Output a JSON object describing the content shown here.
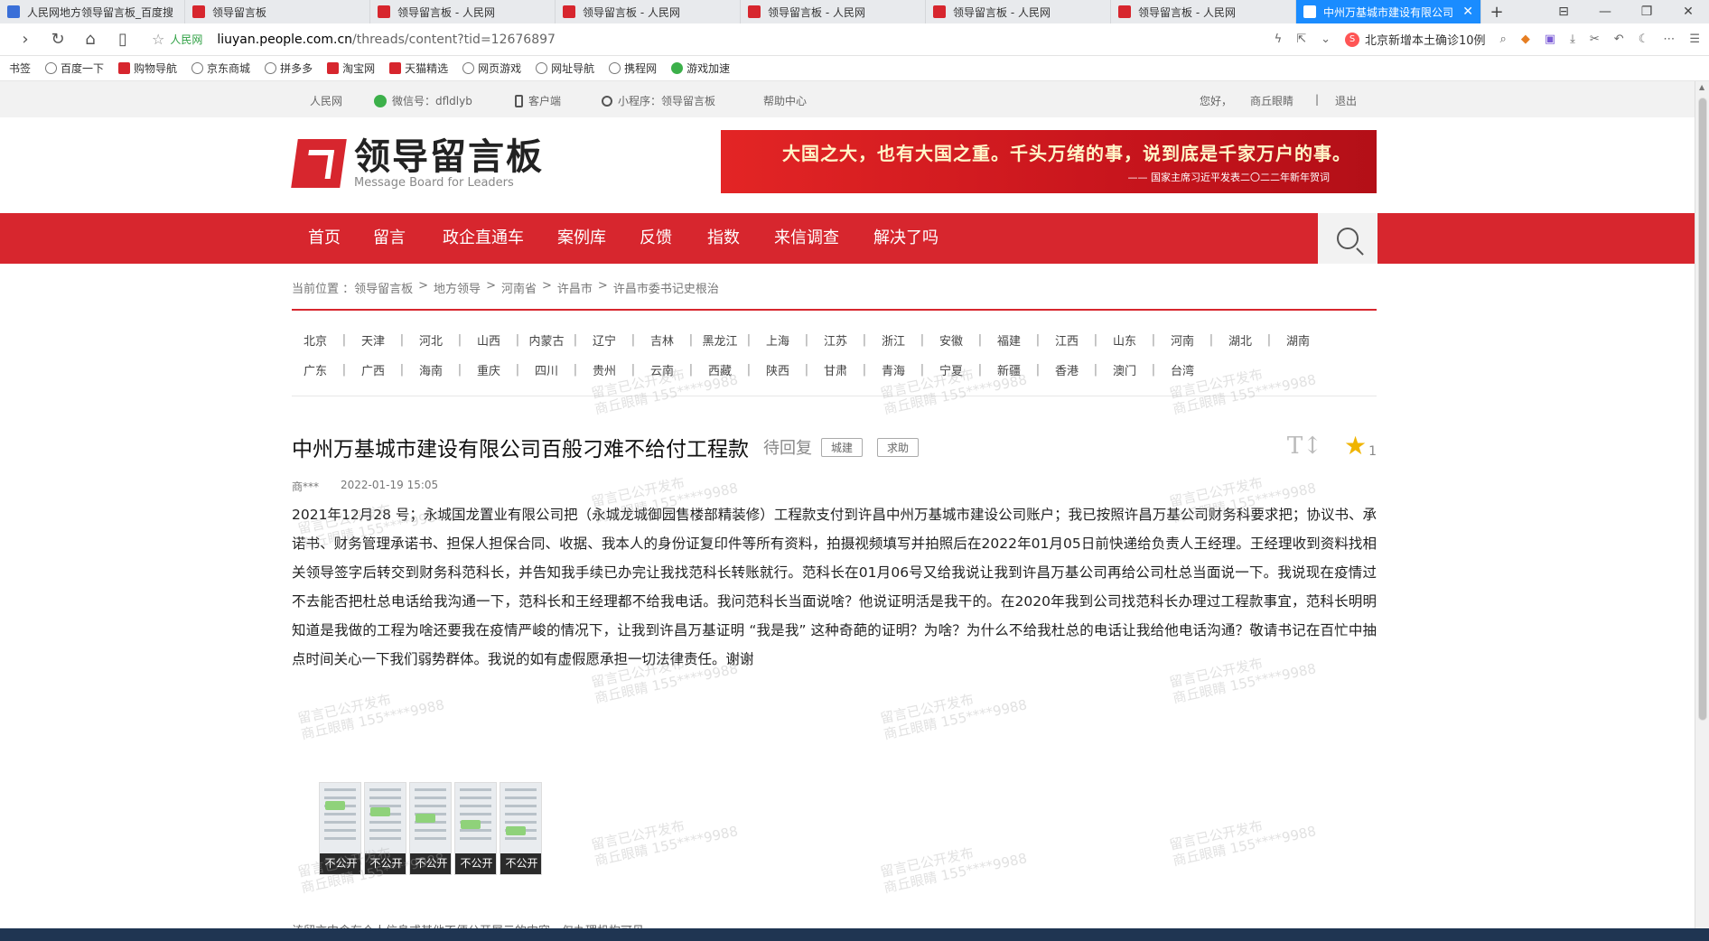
{
  "browser": {
    "tabs": [
      {
        "label": "人民网地方领导留言板_百度搜",
        "icon": "search-icon"
      },
      {
        "label": "领导留言板",
        "icon": "red"
      },
      {
        "label": "领导留言板 - 人民网",
        "icon": "red"
      },
      {
        "label": "领导留言板 - 人民网",
        "icon": "red"
      },
      {
        "label": "领导留言板 - 人民网",
        "icon": "red"
      },
      {
        "label": "领导留言板 - 人民网",
        "icon": "red"
      },
      {
        "label": "领导留言板 - 人民网",
        "icon": "red"
      },
      {
        "label": "中州万基城市建设有限公司",
        "icon": "blue",
        "active": true
      }
    ],
    "new_tab": "+",
    "site_badge": "人民网",
    "url_host": "liuyan.people.com.cn",
    "url_path": "/threads/content?tid=12676897",
    "search_hint": "北京新增本土确诊10例",
    "bookmarks": [
      "书签",
      "百度一下",
      "购物导航",
      "京东商城",
      "拼多多",
      "淘宝网",
      "天猫精选",
      "网页游戏",
      "网址导航",
      "携程网",
      "游戏加速"
    ]
  },
  "topnav": {
    "people": "人民网",
    "wechat": "微信号：dfldlyb",
    "client": "客户端",
    "miniapp": "小程序：领导留言板",
    "help": "帮助中心",
    "hello": "您好，",
    "user": "商丘眼睛",
    "sep": "|",
    "logout": "退出"
  },
  "header": {
    "logo_cn": "领导留言板",
    "logo_en": "Message Board for Leaders",
    "banner_line1": "大国之大，也有大国之重。千头万绪的事，说到底是千家万户的事。",
    "banner_line2": "—— 国家主席习近平发表二〇二二年新年贺词"
  },
  "mainnav": [
    "首页",
    "留言",
    "政企直通车",
    "案例库",
    "反馈",
    "指数",
    "来信调查",
    "解决了吗"
  ],
  "breadcrumb": [
    "当前位置 ：领导留言板",
    ">",
    "地方领导",
    ">",
    "河南省",
    ">",
    "许昌市",
    ">",
    "许昌市委书记史根治"
  ],
  "regions": {
    "row1": [
      "北京",
      "天津",
      "河北",
      "山西",
      "内蒙古",
      "辽宁",
      "吉林",
      "黑龙江",
      "上海",
      "江苏",
      "浙江",
      "安徽",
      "福建",
      "江西",
      "山东",
      "河南",
      "湖北",
      "湖南"
    ],
    "row2": [
      "广东",
      "广西",
      "海南",
      "重庆",
      "四川",
      "贵州",
      "云南",
      "西藏",
      "陕西",
      "甘肃",
      "青海",
      "宁夏",
      "新疆",
      "香港",
      "澳门",
      "台湾"
    ]
  },
  "thread": {
    "title": "中州万基城市建设有限公司百般刁难不给付工程款",
    "status": "待回复",
    "tags": [
      "城建",
      "求助"
    ],
    "font_tool": "T↕",
    "star_count": "1",
    "author": "商***",
    "date": "2022-01-19 15:05",
    "body": "2021年12月28 号；永城国龙置业有限公司把（永城龙城御园售楼部精装修）工程款支付到许昌中州万基城市建设公司账户；我已按照许昌万基公司财务科要求把；协议书、承诺书、财务管理承诺书、担保人担保合同、收据、我本人的身份证复印件等所有资料，拍摄视频填写并拍照后在2022年01月05日前快递给负责人王经理。王经理收到资料找相关领导签字后转交到财务科范科长，并告知我手续已办完让我找范科长转账就行。范科长在01月06号又给我说让我到许昌万基公司再给公司杜总当面说一下。我说现在疫情过不去能否把杜总电话给我沟通一下，范科长和王经理都不给我电话。我问范科长当面说啥？他说证明活是我干的。在2020年我到公司找范科长办理过工程款事宜，范科长明明知道是我做的工程为啥还要我在疫情严峻的情况下，让我到许昌万基证明 “我是我” 这种奇葩的证明？为啥？为什么不给我杜总的电话让我给他电话沟通？敬请书记在百忙中抽点时间关心一下我们弱势群体。我说的如有虚假愿承担一切法律责任。谢谢",
    "attachments": [
      "不公开",
      "不公开",
      "不公开",
      "不公开",
      "不公开"
    ],
    "notice": "该留言中含有个人信息或其他不便公开展示的内容，仅办理机构可见。"
  },
  "watermark": {
    "line1": "留言已公开发布",
    "line2": "商丘眼睛 155****9988"
  }
}
